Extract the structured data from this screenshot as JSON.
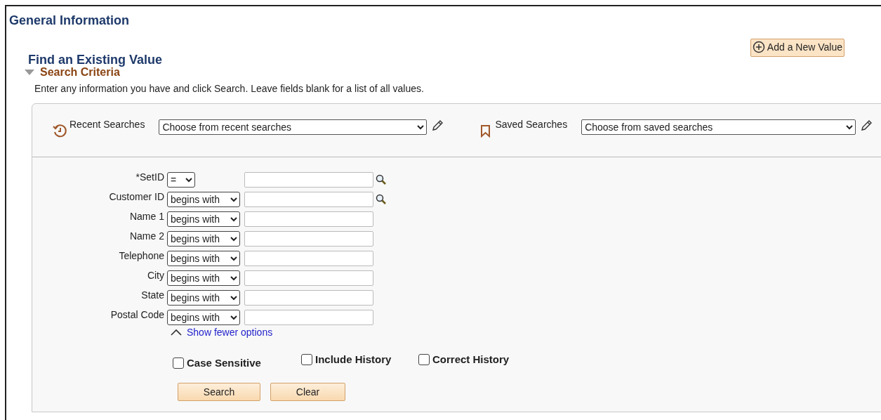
{
  "page_title": "General Information",
  "add_button": {
    "label": "Add a New Value"
  },
  "find_heading": "Find an Existing Value",
  "search_criteria": {
    "label": "Search Criteria",
    "expanded": true
  },
  "instructions": "Enter any information you have and click Search. Leave fields blank for a list of all values.",
  "recent_searches": {
    "label": "Recent Searches",
    "value": "Choose from recent searches"
  },
  "saved_searches": {
    "label": "Saved Searches",
    "value": "Choose from saved searches"
  },
  "criteria": [
    {
      "label": "*SetID",
      "operator": "=",
      "lookup": true
    },
    {
      "label": "Customer ID",
      "operator": "begins with",
      "lookup": true
    },
    {
      "label": "Name 1",
      "operator": "begins with",
      "lookup": false
    },
    {
      "label": "Name 2",
      "operator": "begins with",
      "lookup": false
    },
    {
      "label": "Telephone",
      "operator": "begins with",
      "lookup": false
    },
    {
      "label": "City",
      "operator": "begins with",
      "lookup": false
    },
    {
      "label": "State",
      "operator": "begins with",
      "lookup": false
    },
    {
      "label": "Postal Code",
      "operator": "begins with",
      "lookup": false
    }
  ],
  "options_link": "Show fewer options",
  "checkboxes": [
    {
      "label": "Case Sensitive",
      "checked": false
    },
    {
      "label": "Include History",
      "checked": false
    },
    {
      "label": "Correct History",
      "checked": false
    }
  ],
  "buttons": [
    "Search",
    "Clear"
  ]
}
